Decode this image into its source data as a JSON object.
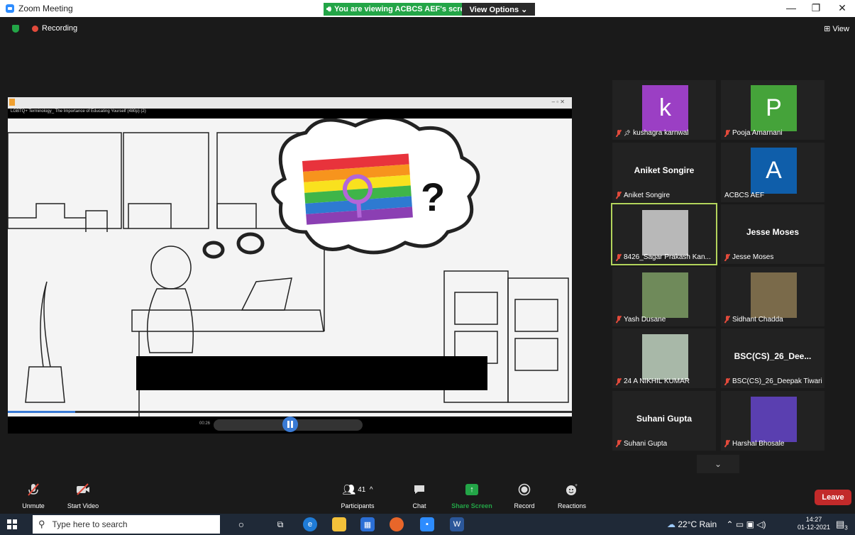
{
  "window": {
    "title": "Zoom Meeting",
    "share_banner": "You are viewing ACBCS AEF's screen",
    "view_options": "View Options ⌄",
    "minimize": "—",
    "maximize": "❐",
    "close": "✕"
  },
  "meeting": {
    "recording_label": "Recording",
    "view_label": "⊞ View"
  },
  "media": {
    "file_title": "LGBTQ+ Terminology_ The Importance of Educating Yourself (480p) (2)",
    "time": "00:26",
    "progress_fraction": 0.12
  },
  "participants": [
    {
      "name": "kushagra karnwal",
      "avatar_letter": "k",
      "avatar_color": "#9b3fc4",
      "muted": true,
      "pinned": true
    },
    {
      "name": "Pooja Amarnani",
      "avatar_letter": "P",
      "avatar_color": "#45a33a",
      "muted": true
    },
    {
      "name": "Aniket Songire",
      "display_name": "Aniket Songire",
      "muted": true
    },
    {
      "name": "ACBCS AEF",
      "avatar_letter": "A",
      "avatar_color": "#0f5eaa",
      "muted": false
    },
    {
      "name": "8426_Sagar Prakash Kan...",
      "muted": true,
      "active": true
    },
    {
      "name": "Jesse Moses",
      "display_name": "Jesse Moses",
      "muted": true
    },
    {
      "name": "Yash Dusane",
      "muted": true
    },
    {
      "name": "Sidhant Chadda",
      "muted": true
    },
    {
      "name": "24 A NIKHIL KUMAR",
      "muted": true
    },
    {
      "name": "BSC(CS)_26_Deepak Tiwari",
      "display_name": "BSC(CS)_26_Dee...",
      "muted": true
    },
    {
      "name": "Suhani Gupta",
      "display_name": "Suhani Gupta",
      "muted": true
    },
    {
      "name": "Harshal Bhosale",
      "muted": true
    }
  ],
  "toolbar": {
    "unmute": "Unmute",
    "start_video": "Start Video",
    "participants_label": "Participants",
    "participants_count": "41",
    "chat": "Chat",
    "share_screen": "Share Screen",
    "record": "Record",
    "reactions": "Reactions",
    "leave": "Leave"
  },
  "taskbar": {
    "search_placeholder": "Type here to search",
    "weather": "22°C  Rain",
    "time": "14:27",
    "date": "01-12-2021",
    "notification_count": "3"
  }
}
